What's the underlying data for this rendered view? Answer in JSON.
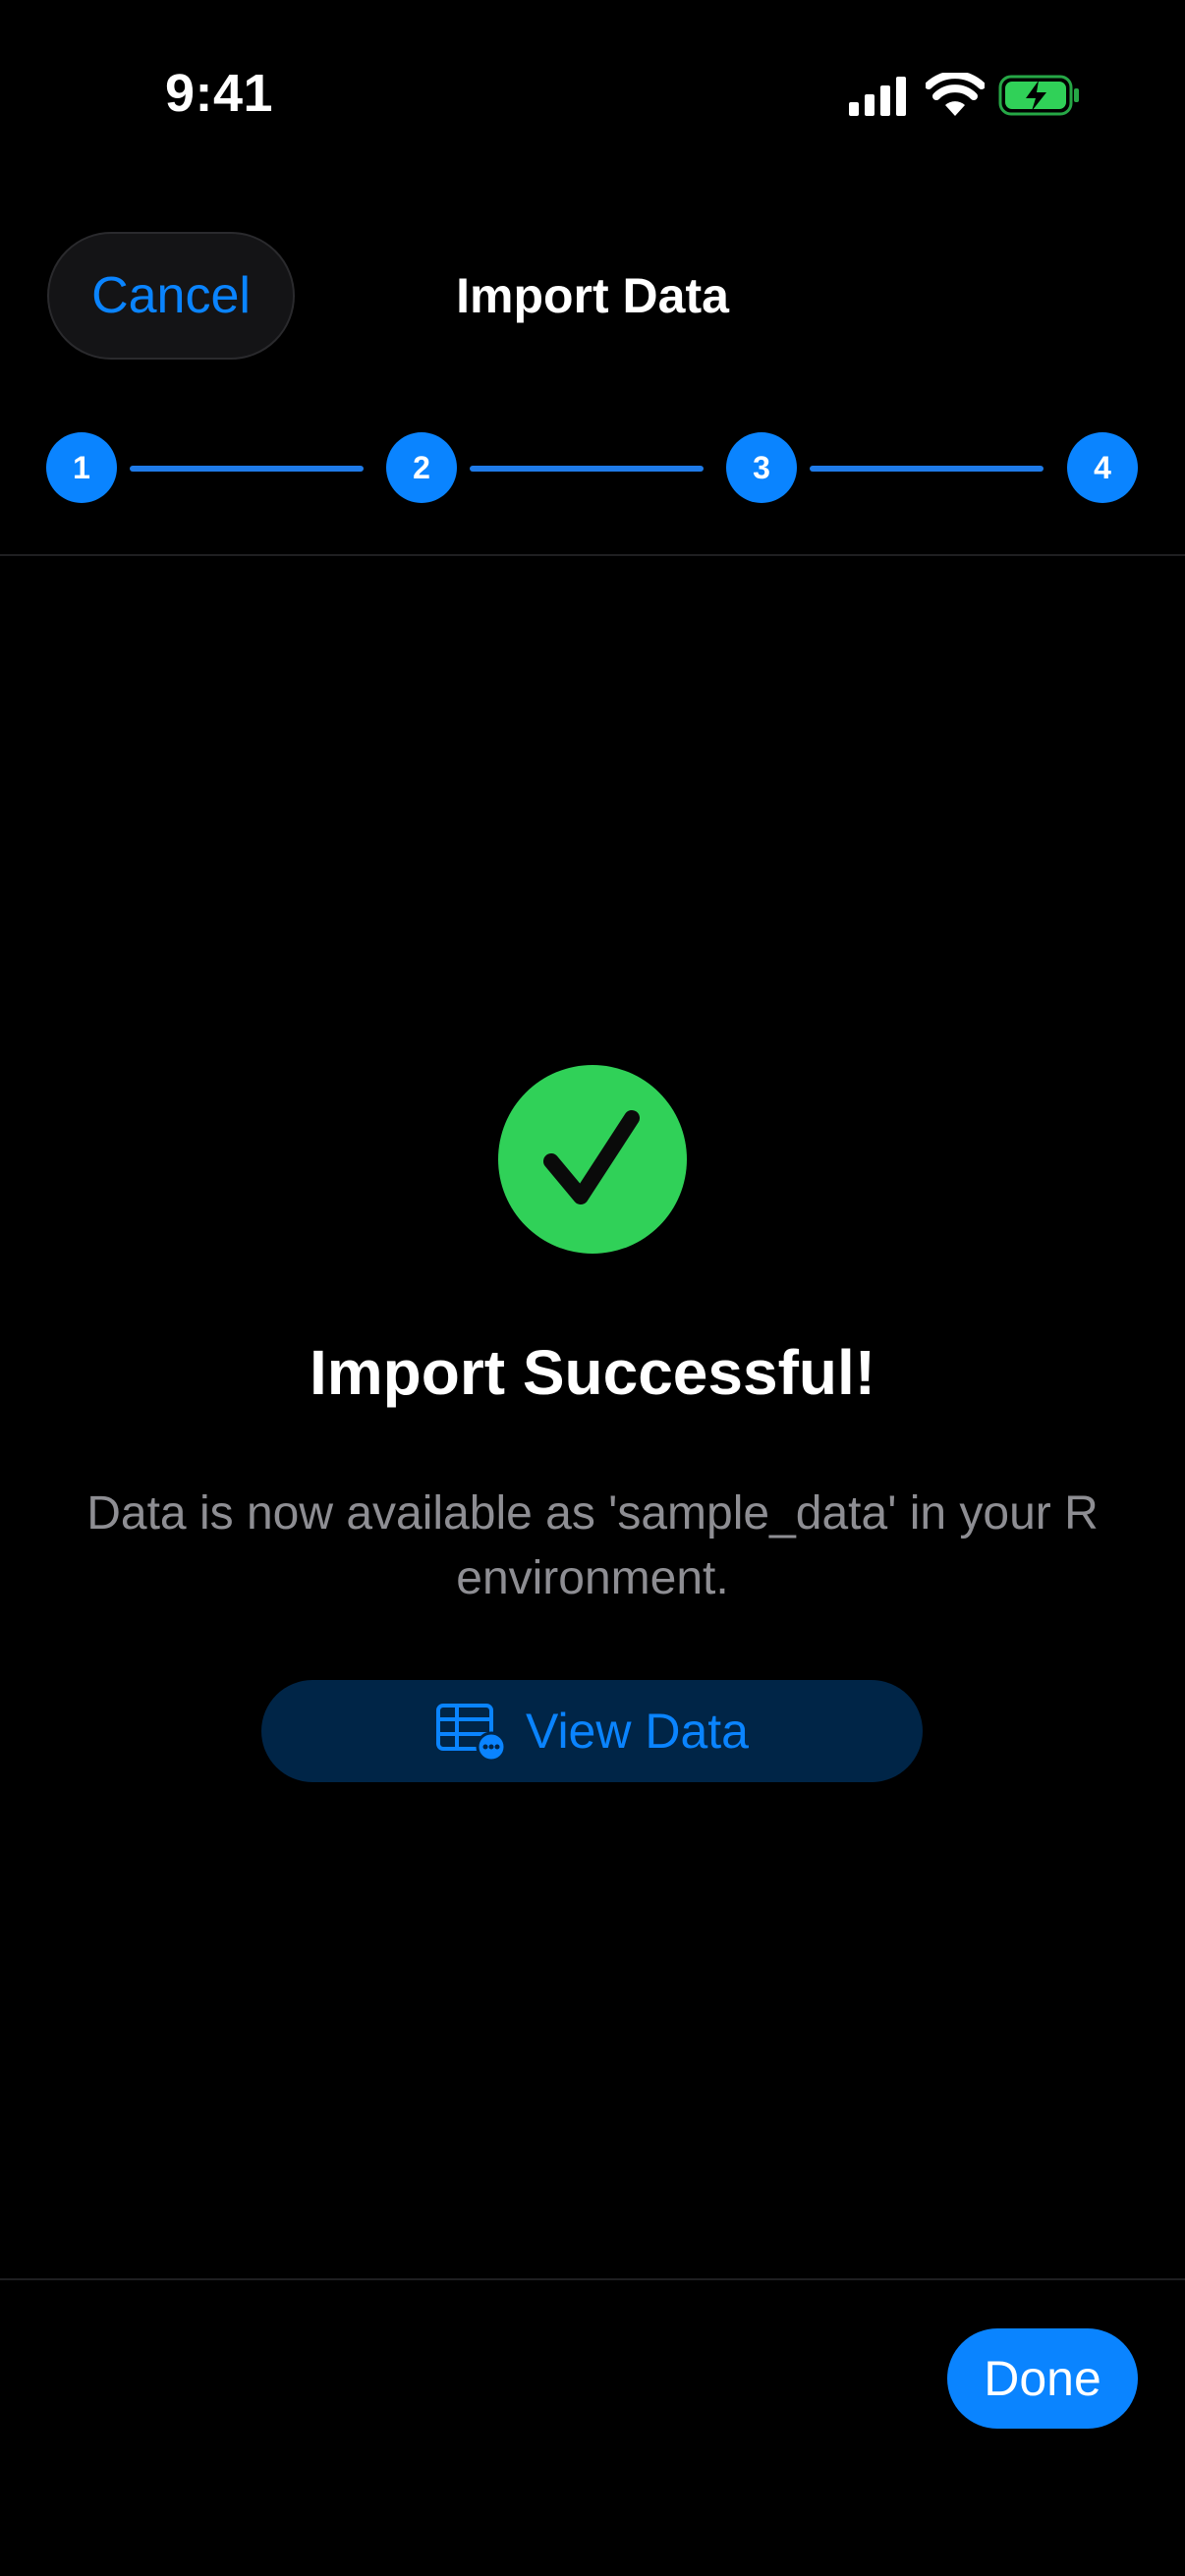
{
  "status_bar": {
    "time": "9:41",
    "icons": [
      "cellular-signal-icon",
      "wifi-icon",
      "battery-charging-icon"
    ]
  },
  "header": {
    "cancel_label": "Cancel",
    "title": "Import Data"
  },
  "stepper": {
    "steps": [
      "1",
      "2",
      "3",
      "4"
    ],
    "current_step": 4
  },
  "result": {
    "icon": "checkmark-circle-icon",
    "title": "Import Successful!",
    "message": "Data is now available as 'sample_data' in your R environment.",
    "view_button_label": "View Data",
    "view_button_icon": "table-icon"
  },
  "footer": {
    "done_label": "Done"
  },
  "colors": {
    "accent": "#0a84ff",
    "success": "#30d158",
    "background": "#000000",
    "secondary_text": "#8e8e93"
  }
}
